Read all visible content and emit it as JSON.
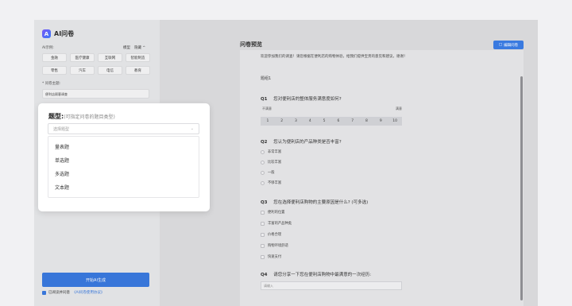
{
  "app": {
    "logo_mark": "A",
    "name": "AI问卷"
  },
  "sidebar": {
    "examples_label": "AI示例:",
    "examples_actions": [
      "模型",
      "隐藏 ^"
    ],
    "tags": [
      "金融",
      "医疗健康",
      "互联网",
      "智能制造",
      "零售",
      "汽车",
      "电信",
      "教育"
    ],
    "topic_label": "* 问卷主题:",
    "topic_value": "便利店顾客调查",
    "generate_button": "开始AI生成",
    "agree_text": "已阅读并同意",
    "agree_link": "《AI问卷使用协议》"
  },
  "dropdown": {
    "title": "题型:",
    "hint": "(可指定问卷的题目类型)",
    "placeholder": "选择题型",
    "chevron": "⌄",
    "options": [
      "量表题",
      "单选题",
      "多选题",
      "文本题"
    ]
  },
  "preview": {
    "title": "问卷预览",
    "edit_button": "编辑问卷",
    "intro": "欢迎参加我们的调查！请您根据在便利店的购物体验，给我们提供宝贵的意见和建议，谢谢！",
    "page_label": "题组1",
    "questions": [
      {
        "num": "Q1",
        "text": "您对便利店的整体服务满意度如何?",
        "type": "scale",
        "low_label": "不满意",
        "high_label": "满意",
        "scale": [
          "1",
          "2",
          "3",
          "4",
          "5",
          "6",
          "7",
          "8",
          "9",
          "10"
        ]
      },
      {
        "num": "Q2",
        "text": "您认为便利店的产品种类是否丰富?",
        "type": "single",
        "options": [
          "非常丰富",
          "比较丰富",
          "一般",
          "不够丰富"
        ]
      },
      {
        "num": "Q3",
        "text": "您在选择便利店购物的主要原因是什么? (可多选)",
        "type": "multi",
        "options": [
          "便利的位置",
          "丰富的产品种类",
          "价格合理",
          "购物环境舒适",
          "快速支付"
        ]
      },
      {
        "num": "Q4",
        "text": "请您分享一下您在便利店购物中最满意的一次经历:",
        "type": "text",
        "placeholder": "请输入"
      }
    ]
  },
  "colors": {
    "accent": "#3a7ae0"
  }
}
